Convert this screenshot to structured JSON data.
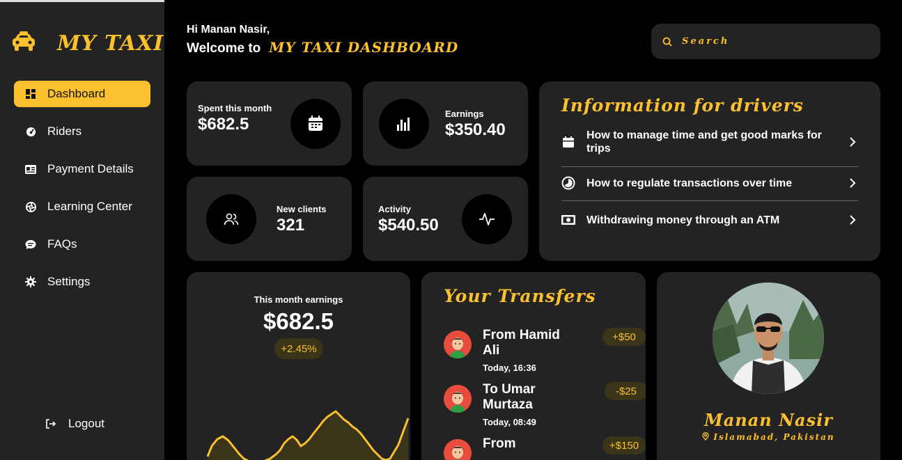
{
  "brand": {
    "name": "MY TAXI"
  },
  "sidebar": {
    "items": [
      {
        "label": "Dashboard",
        "icon": "dashboard-icon",
        "active": true
      },
      {
        "label": "Riders",
        "icon": "gauge-icon"
      },
      {
        "label": "Payment Details",
        "icon": "id-card-icon"
      },
      {
        "label": "Learning Center",
        "icon": "aperture-icon"
      },
      {
        "label": "FAQs",
        "icon": "chat-icon"
      },
      {
        "label": "Settings",
        "icon": "gear-icon"
      }
    ],
    "logout": "Logout"
  },
  "header": {
    "greeting": "Hi Manan Nasir,",
    "welcome": "Welcome to",
    "welcome_brand": "MY TAXI DASHBOARD"
  },
  "search": {
    "placeholder": "Search"
  },
  "stats": {
    "spent": {
      "label": "Spent this month",
      "value": "$682.5",
      "icon": "calendar-icon"
    },
    "earnings": {
      "label": "Earnings",
      "value": "$350.40",
      "icon": "bar-chart-icon"
    },
    "new_clients": {
      "label": "New clients",
      "value": "321",
      "icon": "users-icon"
    },
    "activity": {
      "label": "Activity",
      "value": "$540.50",
      "icon": "pulse-icon"
    }
  },
  "info": {
    "title": "Information for drivers",
    "items": [
      {
        "label": "How to manage time and get good marks for trips",
        "icon": "calendar-icon"
      },
      {
        "label": "How to regulate transactions over time",
        "icon": "pie-icon"
      },
      {
        "label": "Withdrawing money through an ATM",
        "icon": "cash-icon"
      }
    ]
  },
  "earnings_card": {
    "label": "This month earnings",
    "value": "$682.5",
    "change": "+2.45%"
  },
  "transfers": {
    "title": "Your Transfers",
    "items": [
      {
        "name": "From Hamid Ali",
        "time": "Today, 16:36",
        "amount": "+$50"
      },
      {
        "name": "To Umar Murtaza",
        "time": "Today, 08:49",
        "amount": "-$25"
      },
      {
        "name": "From",
        "time": "",
        "amount": "+$150"
      }
    ]
  },
  "profile": {
    "name": "Manan Nasir",
    "location": "Islamabad, Pakistan"
  },
  "colors": {
    "accent": "#fbc02d",
    "card": "#232323",
    "background": "#000000"
  }
}
